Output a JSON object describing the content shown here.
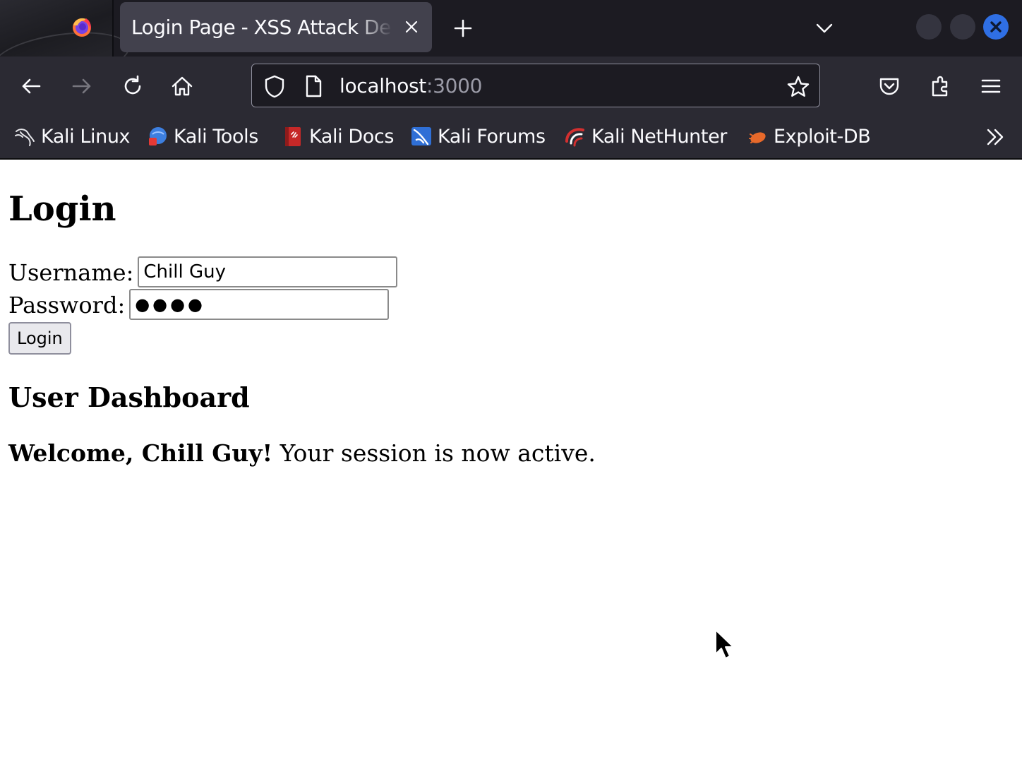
{
  "browser": {
    "tab": {
      "title": "Login Page - XSS Attack Demo",
      "close_label": "Close tab"
    },
    "new_tab_label": "Open a new tab",
    "url": {
      "host": "localhost",
      "port": ":3000"
    },
    "bookmarks": [
      {
        "label": "Kali Linux",
        "icon": "kali-dragon-icon"
      },
      {
        "label": "Kali Tools",
        "icon": "kali-tools-icon"
      },
      {
        "label": "Kali Docs",
        "icon": "kali-docs-icon"
      },
      {
        "label": "Kali Forums",
        "icon": "kali-forums-icon"
      },
      {
        "label": "Kali NetHunter",
        "icon": "kali-nethunter-icon"
      },
      {
        "label": "Exploit-DB",
        "icon": "exploit-db-icon"
      }
    ],
    "colors": {
      "chrome": "#2b2a33",
      "tabstrip": "#1c1b22",
      "active_tab": "#42414d",
      "close_accent": "#2f6fe4"
    }
  },
  "page": {
    "title": "Login",
    "username_label": "Username:",
    "username_value": "Chill Guy",
    "password_label": "Password:",
    "password_value": "●●●●",
    "login_button": "Login",
    "dashboard_title": "User Dashboard",
    "welcome_bold": "Welcome, Chill Guy!",
    "welcome_rest": " Your session is now active."
  }
}
